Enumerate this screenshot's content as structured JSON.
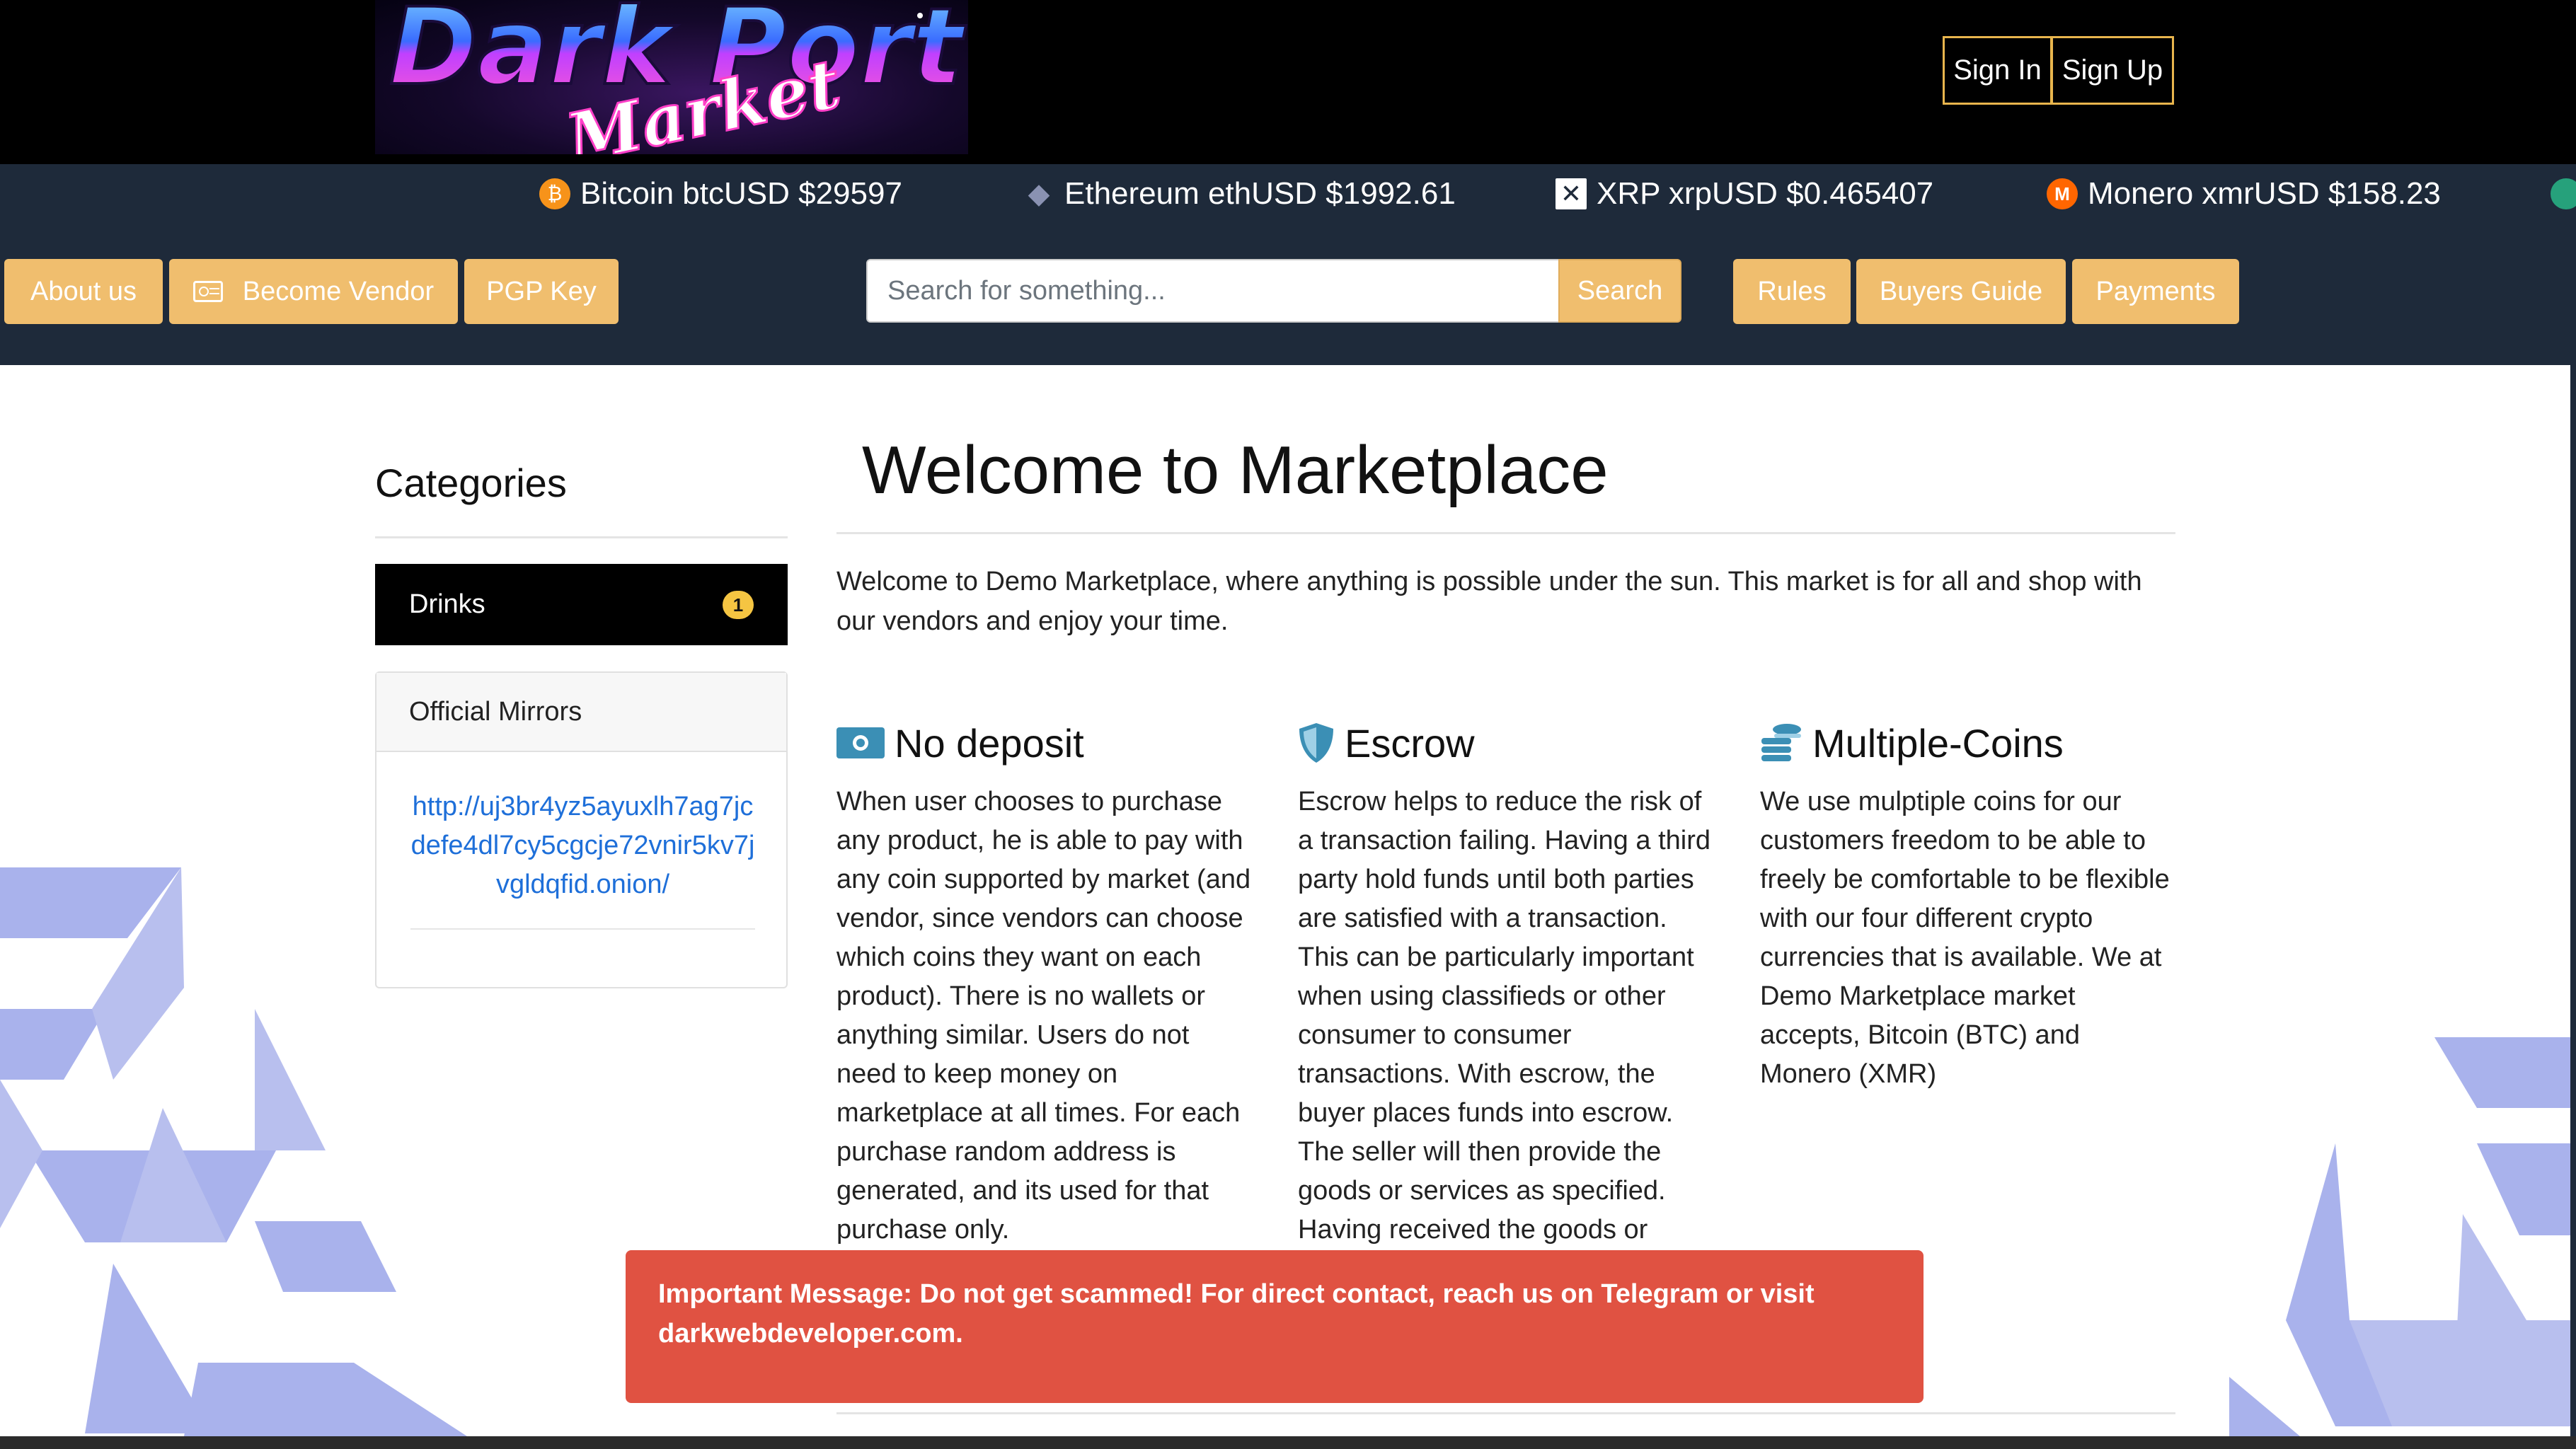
{
  "header": {
    "logo_text_primary": "Dark Port",
    "logo_text_secondary": "Market",
    "sign_in": "Sign In",
    "sign_up": "Sign Up"
  },
  "ticker": [
    {
      "icon": "bitcoin-icon",
      "color": "#f7931a",
      "name": "Bitcoin",
      "pair": "btcUSD",
      "price": "$29597",
      "text": "Bitcoin btcUSD $29597"
    },
    {
      "icon": "ethereum-icon",
      "color": "#8a92b2",
      "name": "Ethereum",
      "pair": "ethUSD",
      "price": "$1992.61",
      "text": "Ethereum ethUSD $1992.61"
    },
    {
      "icon": "xrp-icon",
      "color": "#ffffff",
      "name": "XRP",
      "pair": "xrpUSD",
      "price": "$0.465407",
      "text": "XRP xrpUSD $0.465407"
    },
    {
      "icon": "monero-icon",
      "color": "#ff6600",
      "name": "Monero",
      "pair": "xmrUSD",
      "price": "$158.23",
      "text": "Monero xmrUSD $158.23"
    }
  ],
  "nav": {
    "about": "About us",
    "vendor": "Become Vendor",
    "pgp": "PGP Key",
    "search_placeholder": "Search for something...",
    "search_button": "Search",
    "rules": "Rules",
    "buyers_guide": "Buyers Guide",
    "payments": "Payments"
  },
  "sidebar": {
    "title": "Categories",
    "categories": [
      {
        "label": "Drinks",
        "count": "1"
      }
    ],
    "mirrors_title": "Official Mirrors",
    "mirror_link": "http://uj3br4yz5ayuxlh7ag7jcdefe4dl7cy5cgcje72vnir5kv7jvgldqfid.onion/"
  },
  "main": {
    "title": "Welcome to Marketplace",
    "intro": "Welcome to Demo Marketplace, where anything is possible under the sun. This market is for all and shop with our vendors and enjoy your time.",
    "features": [
      {
        "icon": "money-bill-icon",
        "title": "No deposit",
        "text": "When user chooses to purchase any product, he is able to pay with any coin supported by market (and vendor, since vendors can choose which coins they want on each product). There is no wallets or anything similar. Users do not need to keep money on marketplace at all times. For each purchase random address is generated, and its used for that purchase only."
      },
      {
        "icon": "shield-icon",
        "title": "Escrow",
        "text": "Escrow helps to reduce the risk of a transaction failing. Having a third party hold funds until both parties are satisfied with a transaction. This can be particularly important when using classifieds or other consumer to consumer transactions. With escrow, the buyer places funds into escrow. The seller will then provide the goods or services as specified. Having received the goods or"
      },
      {
        "icon": "coins-icon",
        "title": "Multiple-Coins",
        "text": "We use mulptiple coins for our customers freedom to be able to freely be comfortable to be flexible with our four different crypto currencies that is available. We at Demo Marketplace market accepts, Bitcoin (BTC) and Monero (XMR)"
      }
    ]
  },
  "alert": {
    "text": "Important Message: Do not get scammed! For direct contact, reach us on Telegram or visit darkwebdeveloper.com."
  },
  "colors": {
    "accent": "#f0be6e",
    "nav_bg": "#1e2a3a",
    "alert_bg": "#e05242",
    "link": "#1e6fd9"
  }
}
